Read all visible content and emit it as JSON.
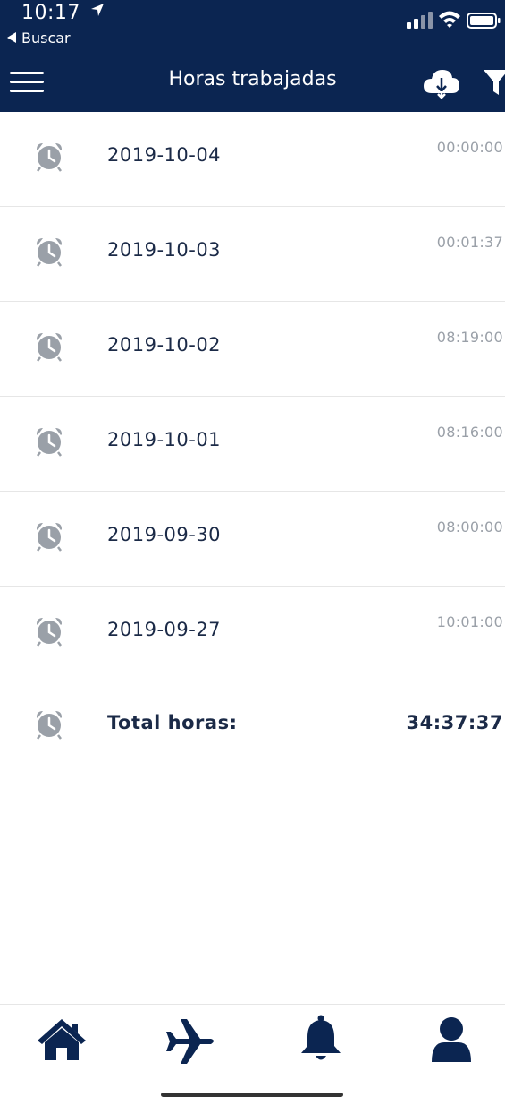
{
  "status_bar": {
    "time": "10:17",
    "back_label": "Buscar"
  },
  "header": {
    "title": "Horas trabajadas"
  },
  "records": [
    {
      "date": "2019-10-04",
      "duration": "00:00:00"
    },
    {
      "date": "2019-10-03",
      "duration": "00:01:37"
    },
    {
      "date": "2019-10-02",
      "duration": "08:19:00"
    },
    {
      "date": "2019-10-01",
      "duration": "08:16:00"
    },
    {
      "date": "2019-09-30",
      "duration": "08:00:00"
    },
    {
      "date": "2019-09-27",
      "duration": "10:01:00"
    }
  ],
  "total": {
    "label": "Total horas:",
    "value": "34:37:37"
  },
  "tabbar": {
    "items": [
      {
        "icon": "home-icon"
      },
      {
        "icon": "airplane-icon"
      },
      {
        "icon": "bell-icon"
      },
      {
        "icon": "user-icon"
      }
    ]
  },
  "colors": {
    "primary": "#0b2551",
    "muted": "#9aa0a8",
    "text": "#1b2a47"
  }
}
